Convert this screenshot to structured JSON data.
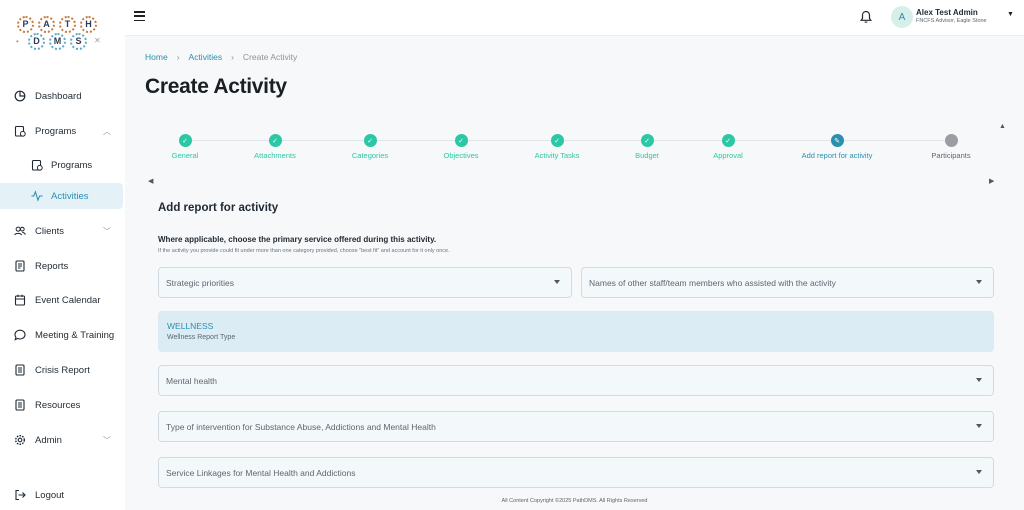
{
  "logo": {
    "top_letters": [
      "P",
      "A",
      "T",
      "H"
    ],
    "bottom_letters": [
      "D",
      "M",
      "S"
    ]
  },
  "sidebar": {
    "items": [
      {
        "label": "Dashboard",
        "icon": "pie-chart-icon"
      },
      {
        "label": "Programs",
        "icon": "clipboard-icon",
        "expandable": true
      },
      {
        "label": "Programs",
        "icon": "clipboard-icon",
        "sub": true
      },
      {
        "label": "Activities",
        "icon": "activity-icon",
        "sub": true,
        "active": true
      },
      {
        "label": "Clients",
        "icon": "users-icon",
        "expandable": true
      },
      {
        "label": "Reports",
        "icon": "report-icon"
      },
      {
        "label": "Event Calendar",
        "icon": "calendar-icon"
      },
      {
        "label": "Meeting & Training",
        "icon": "chat-icon"
      },
      {
        "label": "Crisis Report",
        "icon": "document-icon"
      },
      {
        "label": "Resources",
        "icon": "document-icon"
      },
      {
        "label": "Admin",
        "icon": "gear-icon",
        "expandable": true
      }
    ],
    "logout_label": "Logout"
  },
  "user": {
    "initial": "A",
    "name": "Alex Test Admin",
    "role": "FNCFS Advisor, Eagle Stone"
  },
  "breadcrumb": {
    "home": "Home",
    "sep": "›",
    "activities": "Activities",
    "current": "Create Activity"
  },
  "page_title": "Create Activity",
  "stepper": {
    "steps": [
      {
        "label": "General",
        "state": "done"
      },
      {
        "label": "Attachments",
        "state": "done"
      },
      {
        "label": "Categories",
        "state": "done"
      },
      {
        "label": "Objectives",
        "state": "done"
      },
      {
        "label": "Activity Tasks",
        "state": "done"
      },
      {
        "label": "Budget",
        "state": "done"
      },
      {
        "label": "Approval",
        "state": "done"
      },
      {
        "label": "Add report for activity",
        "state": "current"
      },
      {
        "label": "Participants",
        "state": "pending"
      }
    ]
  },
  "form": {
    "section_title": "Add report for activity",
    "question": "Where applicable, choose the primary service offered during this activity.",
    "hint": "If the activity you provide could fit under more than one category provided, choose \"best fit\" and account for it only once.",
    "strategic_priorities_placeholder": "Strategic priorities",
    "staff_placeholder": "Names of other staff/team members who assisted with the activity",
    "wellness_title": "WELLNESS",
    "wellness_sub": "Wellness Report Type",
    "mental_health_placeholder": "Mental health",
    "intervention_placeholder": "Type of intervention for Substance Abuse, Addictions and Mental Health",
    "linkages_placeholder": "Service Linkages for Mental Health and Addictions"
  },
  "colors": {
    "accent": "#2b8fb0",
    "done": "#2cc7a4",
    "pending": "#9a9ea3",
    "panel": "#dcecf5"
  },
  "footer": "All Content Copyright ©2025 PathDMS. All Rights Reserved"
}
